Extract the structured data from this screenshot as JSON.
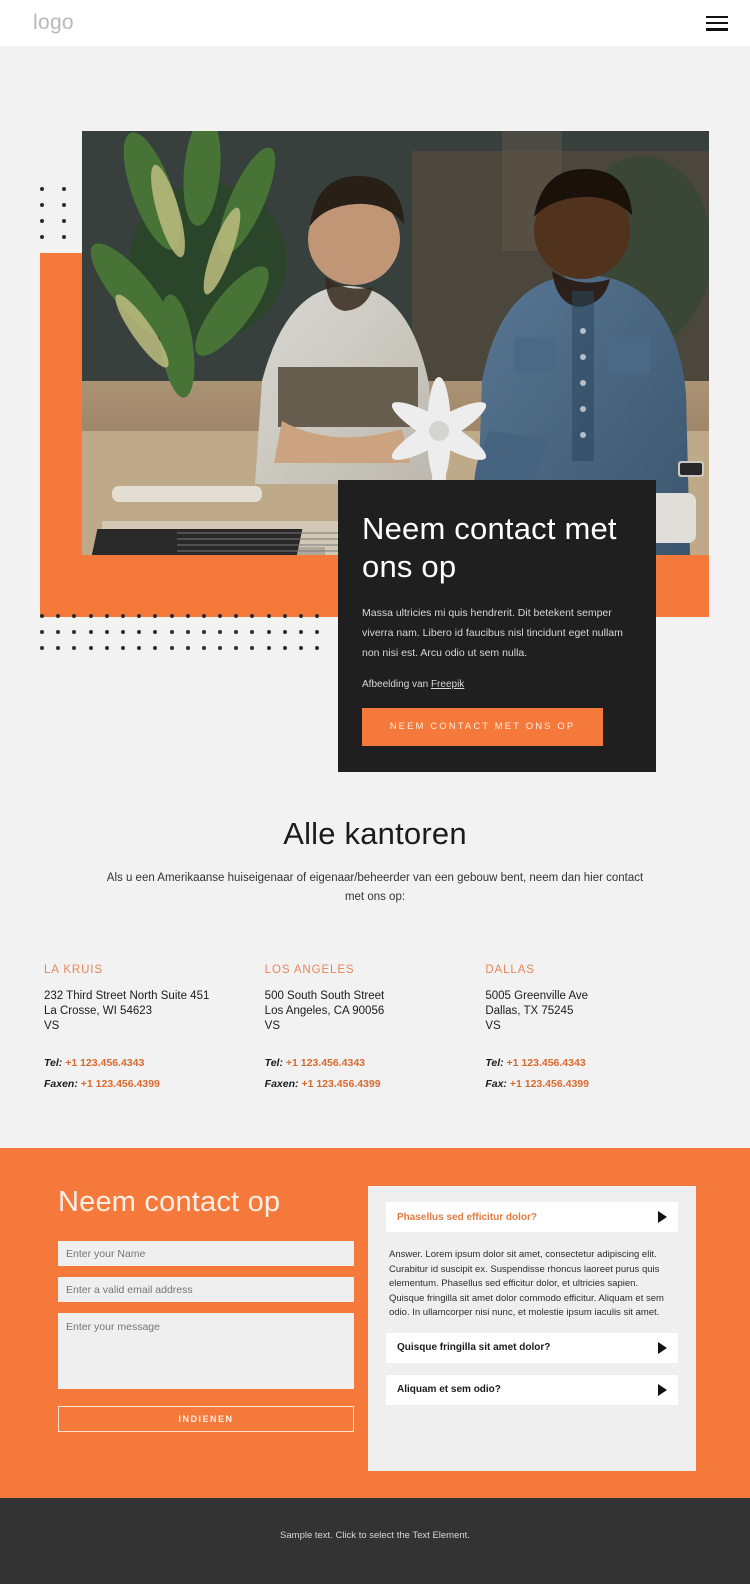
{
  "header": {
    "logo": "logo",
    "menu_icon": "hamburger-icon"
  },
  "hero": {
    "title": "Neem contact met ons op",
    "body": "Massa ultricies mi quis hendrerit. Dit betekent semper viverra nam. Libero id faucibus nisl tincidunt eget nullam non nisi est. Arcu odio ut sem nulla.",
    "credit_prefix": "Afbeelding van ",
    "credit_link": "Freepik",
    "cta_label": "NEEM CONTACT MET ONS OP",
    "image_alt": "Two men examining a wind turbine model on a desk in an office"
  },
  "offices": {
    "title": "Alle kantoren",
    "subtitle": "Als u een Amerikaanse huiseigenaar of eigenaar/beheerder van een gebouw bent, neem dan hier contact met ons op:",
    "items": [
      {
        "city": "LA KRUIS",
        "address_line1": "232 Third Street North Suite 451",
        "address_line2": "La Crosse, WI 54623",
        "address_line3": "VS",
        "tel_label": "Tel:",
        "tel_value": "+1 123.456.4343",
        "fax_label": "Faxen:",
        "fax_value": "+1 123.456.4399"
      },
      {
        "city": "LOS ANGELES",
        "address_line1": "500 South South Street",
        "address_line2": "Los Angeles, CA 90056",
        "address_line3": "VS",
        "tel_label": "Tel:",
        "tel_value": "+1 123.456.4343",
        "fax_label": "Faxen:",
        "fax_value": "+1 123.456.4399"
      },
      {
        "city": "DALLAS",
        "address_line1": "5005 Greenville Ave",
        "address_line2": "Dallas, TX 75245",
        "address_line3": "VS",
        "tel_label": "Tel:",
        "tel_value": "+1 123.456.4343",
        "fax_label": "Fax:",
        "fax_value": "+1 123.456.4399"
      }
    ]
  },
  "contact": {
    "title": "Neem contact op",
    "name_placeholder": "Enter your Name",
    "email_placeholder": "Enter a valid email address",
    "message_placeholder": "Enter your message",
    "submit_label": "INDIENEN"
  },
  "faq": {
    "items": [
      {
        "question": "Phasellus sed efficitur dolor?",
        "open": true,
        "answer": "Answer. Lorem ipsum dolor sit amet, consectetur adipiscing elit. Curabitur id suscipit ex. Suspendisse rhoncus laoreet purus quis elementum. Phasellus sed efficitur dolor, et ultricies sapien. Quisque fringilla sit amet dolor commodo efficitur. Aliquam et sem odio. In ullamcorper nisi nunc, et molestie ipsum iaculis sit amet."
      },
      {
        "question": "Quisque fringilla sit amet dolor?",
        "open": false
      },
      {
        "question": "Aliquam et sem odio?",
        "open": false
      }
    ]
  },
  "footer": {
    "text": "Sample text. Click to select the Text Element."
  },
  "colors": {
    "accent_orange": "#F5793A",
    "dark_card": "#1f1f1f",
    "page_bg": "#f2f2f2",
    "footer_bg": "#333333",
    "link_orange": "#d96a2e"
  }
}
